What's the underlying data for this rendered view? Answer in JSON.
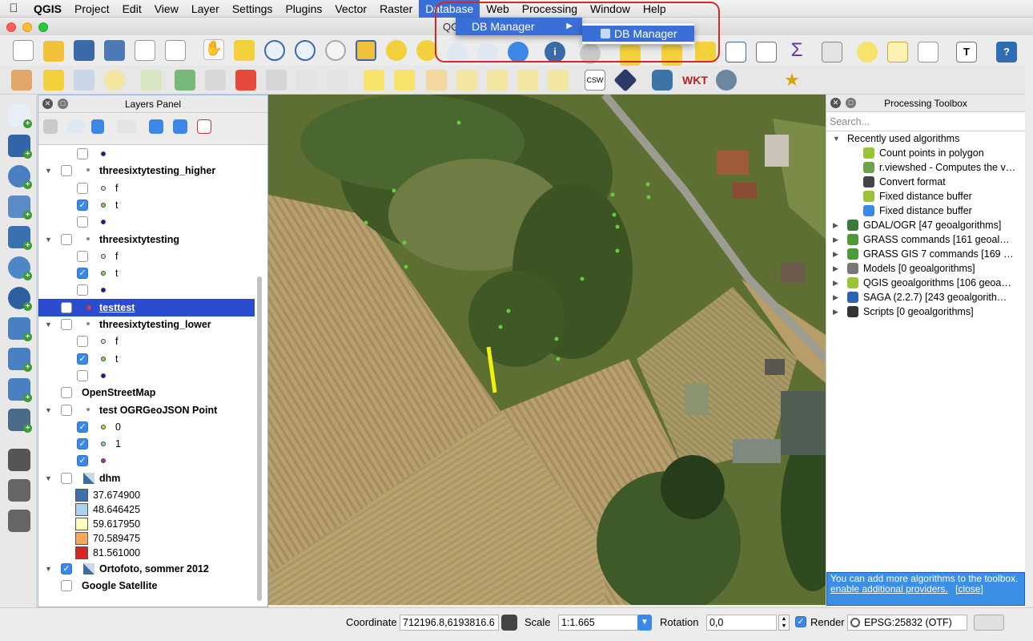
{
  "menubar": {
    "app": "QGIS",
    "items": [
      "Project",
      "Edit",
      "View",
      "Layer",
      "Settings",
      "Plugins",
      "Vector",
      "Raster",
      "Database",
      "Web",
      "Processing",
      "Window",
      "Help"
    ],
    "active": "Database"
  },
  "window": {
    "title": "QGIS"
  },
  "database_menu": {
    "item": "DB Manager",
    "submenu_item": "DB Manager"
  },
  "layers_panel": {
    "title": "Layers Panel",
    "rows": [
      {
        "label": "",
        "indent": 2,
        "checked": false,
        "symbol": "#1a1aa0",
        "bold": false
      },
      {
        "label": "threesixtytesting_higher",
        "indent": 1,
        "checked": false,
        "group": true,
        "bold": true
      },
      {
        "label": "f",
        "indent": 2,
        "checked": false,
        "symbol": "#f3d7cf",
        "bold": false
      },
      {
        "label": "t",
        "indent": 2,
        "checked": true,
        "symbol": "#7ee04a",
        "bold": false
      },
      {
        "label": "",
        "indent": 2,
        "checked": false,
        "symbol": "#1a1aa0",
        "bold": false
      },
      {
        "label": "threesixtytesting",
        "indent": 1,
        "checked": false,
        "group": true,
        "bold": true
      },
      {
        "label": "f",
        "indent": 2,
        "checked": false,
        "symbol": "#f3d7cf",
        "bold": false
      },
      {
        "label": "t",
        "indent": 2,
        "checked": true,
        "symbol": "#7ee04a",
        "bold": false
      },
      {
        "label": "",
        "indent": 2,
        "checked": false,
        "symbol": "#1a1aa0",
        "bold": false
      },
      {
        "label": "testtest",
        "indent": 1,
        "checked": false,
        "symbol": "#d04040",
        "bold": true,
        "selected": true
      },
      {
        "label": "threesixtytesting_lower",
        "indent": 1,
        "checked": false,
        "group": true,
        "bold": true
      },
      {
        "label": "f",
        "indent": 2,
        "checked": false,
        "symbol": "#f3e0cc",
        "bold": false
      },
      {
        "label": "t",
        "indent": 2,
        "checked": true,
        "symbol": "#7ee04a",
        "bold": false
      },
      {
        "label": "",
        "indent": 2,
        "checked": false,
        "symbol": "#1a1aa0",
        "bold": false
      },
      {
        "label": "OpenStreetMap",
        "indent": 1,
        "checked": false,
        "bold": true,
        "nosym": true
      },
      {
        "label": "test OGRGeoJSON Point",
        "indent": 1,
        "checked": false,
        "group": true,
        "bold": true
      },
      {
        "label": "0",
        "indent": 2,
        "checked": true,
        "symbol": "#d6d63a",
        "bold": false
      },
      {
        "label": "1",
        "indent": 2,
        "checked": true,
        "symbol": "#8fd0c9",
        "bold": false
      },
      {
        "label": "",
        "indent": 2,
        "checked": true,
        "symbol": "#b12fb1",
        "bold": false
      },
      {
        "label": "dhm",
        "indent": 1,
        "checked": false,
        "group": true,
        "bold": true,
        "raster": true
      }
    ],
    "dhm_legend": [
      {
        "value": "37.674900",
        "color": "#3f6fad"
      },
      {
        "value": "48.646425",
        "color": "#a9d2ec"
      },
      {
        "value": "59.617950",
        "color": "#fdfdbf"
      },
      {
        "value": "70.589475",
        "color": "#f7a85e"
      },
      {
        "value": "81.561000",
        "color": "#d7261e"
      }
    ],
    "bottom_rows": [
      {
        "label": "Ortofoto, sommer 2012",
        "checked": true,
        "raster": true
      },
      {
        "label": "Google Satellite",
        "checked": false
      }
    ]
  },
  "processing": {
    "title": "Processing Toolbox",
    "search_placeholder": "Search...",
    "recent_label": "Recently used algorithms",
    "recent": [
      "Count points in polygon",
      "r.viewshed - Computes the v…",
      "Convert format",
      "Fixed distance buffer",
      "Fixed distance buffer"
    ],
    "providers": [
      "GDAL/OGR [47 geoalgorithms]",
      "GRASS commands [161 geoal…",
      "GRASS GIS 7 commands [169 …",
      "Models [0 geoalgorithms]",
      "QGIS geoalgorithms [106 geoa…",
      "SAGA (2.2.7) [243 geoalgorith…",
      "Scripts [0 geoalgorithms]"
    ],
    "hint_text": "You can add more algorithms to the toolbox.",
    "hint_link": "enable additional providers.",
    "hint_close": "[close]"
  },
  "statusbar": {
    "coordinate_label": "Coordinate",
    "coordinate_value": "712196.8,6193816.6",
    "scale_label": "Scale",
    "scale_value": "1:1.665",
    "rotation_label": "Rotation",
    "rotation_value": "0,0",
    "render_label": "Render",
    "crs": "EPSG:25832 (OTF)"
  }
}
